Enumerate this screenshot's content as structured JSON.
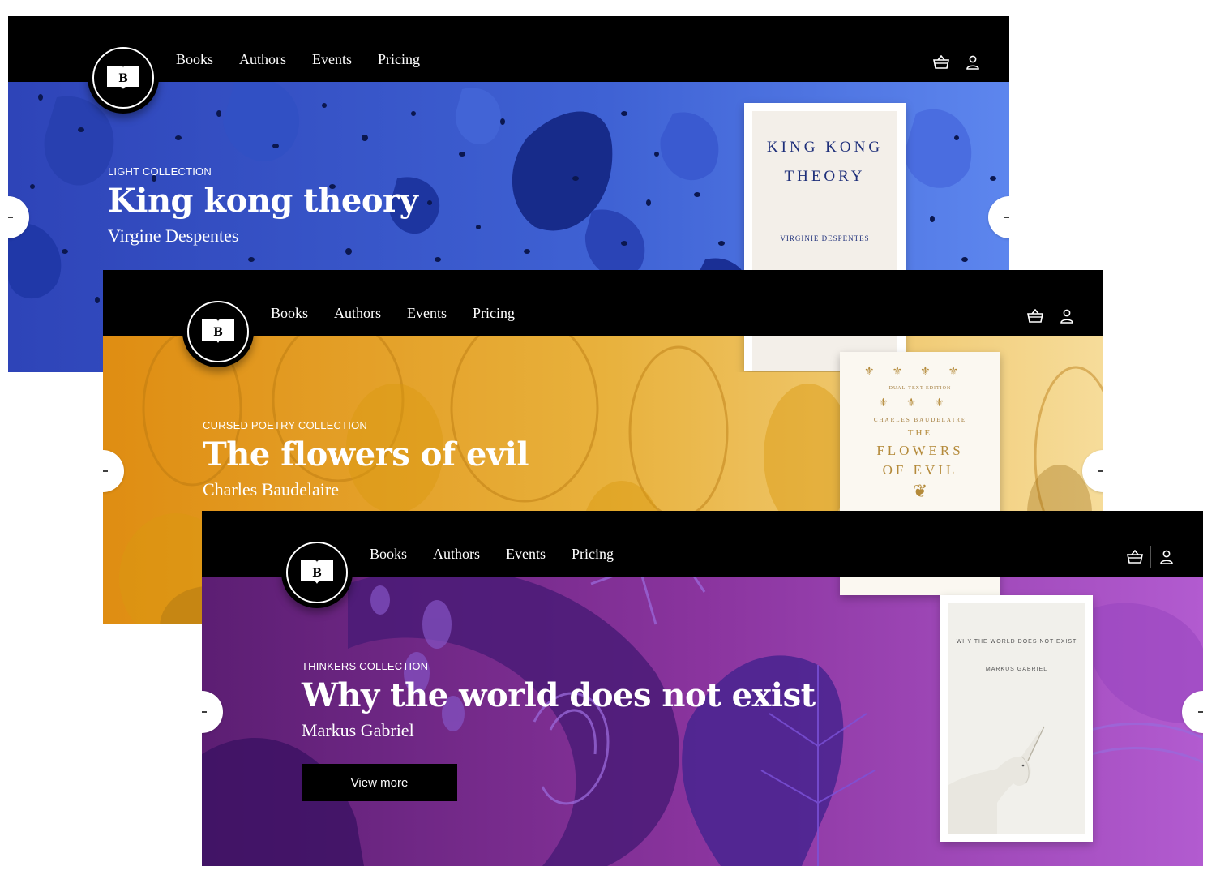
{
  "nav": {
    "links": [
      "Books",
      "Authors",
      "Events",
      "Pricing"
    ],
    "logo_letter": "B"
  },
  "icons": {
    "cart": "basket-icon",
    "user": "user-icon",
    "prev": "arrow-left-icon",
    "next": "arrow-right-icon"
  },
  "slides": [
    {
      "collection": "LIGHT COLLECTION",
      "title": "King kong theory",
      "author": "Virgine Despentes",
      "bg_color": "#3c5ccc",
      "cover": {
        "line1": "KING KONG",
        "line2": "THEORY",
        "author": "VIRGINIE DESPENTES"
      }
    },
    {
      "collection": "CURSED POETRY COLLECTION",
      "title": "The flowers of evil",
      "author": "Charles Baudelaire",
      "bg_color": "#e7aa2e",
      "cover": {
        "edition": "DUAL-TEXT EDITION",
        "author": "CHARLES BAUDELAIRE",
        "line1": "THE",
        "line2": "FLOWERS",
        "line3": "OF EVIL"
      }
    },
    {
      "collection": "THINKERS COLLECTION",
      "title": "Why the world does not exist",
      "author": "Markus Gabriel",
      "bg_color": "#7a2f95",
      "cta_label": "View more",
      "cover": {
        "title": "WHY THE WORLD DOES NOT EXIST",
        "author": "MARKUS GABRIEL"
      }
    }
  ]
}
